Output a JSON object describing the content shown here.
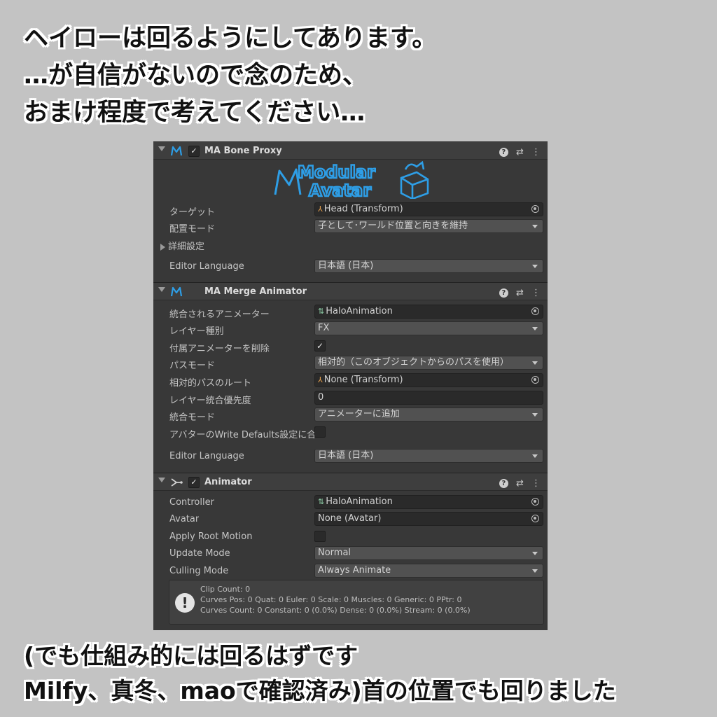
{
  "caption_top": [
    "ヘイローは回るようにしてあります。",
    "…が自信がないので念のため、",
    "おまけ程度で考えてください…"
  ],
  "caption_bottom": [
    "(でも仕組み的には回るはずです",
    "Milfy、真冬、maoで確認済み)首の位置でも回りました"
  ],
  "header_icons": {
    "help": "?",
    "presets": "⇄",
    "more": "⋮"
  },
  "bone_proxy": {
    "title": "MA Bone Proxy",
    "enabled_mark": "✓",
    "logo_line1": "Modular",
    "logo_line2": "Avatar",
    "target_label": "ターゲット",
    "target_value": "Head (Transform)",
    "placement_label": "配置モード",
    "placement_value": "子として･ワールド位置と向きを維持",
    "advanced_label": "詳細設定",
    "language_label": "Editor Language",
    "language_value": "日本語 (日本)"
  },
  "merge_animator": {
    "title": "MA Merge Animator",
    "animator_label": "統合されるアニメーター",
    "animator_value": "HaloAnimation",
    "layer_type_label": "レイヤー種別",
    "layer_type_value": "FX",
    "delete_attached_label": "付属アニメーターを削除",
    "delete_attached_mark": "✓",
    "path_mode_label": "パスモード",
    "path_mode_value": "相対的（このオブジェクトからのパスを使用）",
    "relative_root_label": "相対的パスのルート",
    "relative_root_value": "None (Transform)",
    "layer_priority_label": "レイヤー統合優先度",
    "layer_priority_value": "0",
    "merge_mode_label": "統合モード",
    "merge_mode_value": "アニメーターに追加",
    "write_defaults_label": "アバターのWrite Defaults設定に合",
    "language_label": "Editor Language",
    "language_value": "日本語 (日本)"
  },
  "animator": {
    "title": "Animator",
    "enabled_mark": "✓",
    "controller_label": "Controller",
    "controller_value": "HaloAnimation",
    "avatar_label": "Avatar",
    "avatar_value": "None (Avatar)",
    "root_motion_label": "Apply Root Motion",
    "update_mode_label": "Update Mode",
    "update_mode_value": "Normal",
    "culling_mode_label": "Culling Mode",
    "culling_mode_value": "Always Animate",
    "info_mark": "!",
    "info_line1": "Clip Count: 0",
    "info_line2": "Curves Pos: 0 Quat: 0 Euler: 0 Scale: 0 Muscles: 0 Generic: 0 PPtr: 0",
    "info_line3": "Curves Count: 0 Constant: 0 (0.0%) Dense: 0 (0.0%) Stream: 0 (0.0%)"
  },
  "colors": {
    "logo_blue": "#2e9ee6",
    "background": "#c3c3c3",
    "panel": "#383838"
  }
}
